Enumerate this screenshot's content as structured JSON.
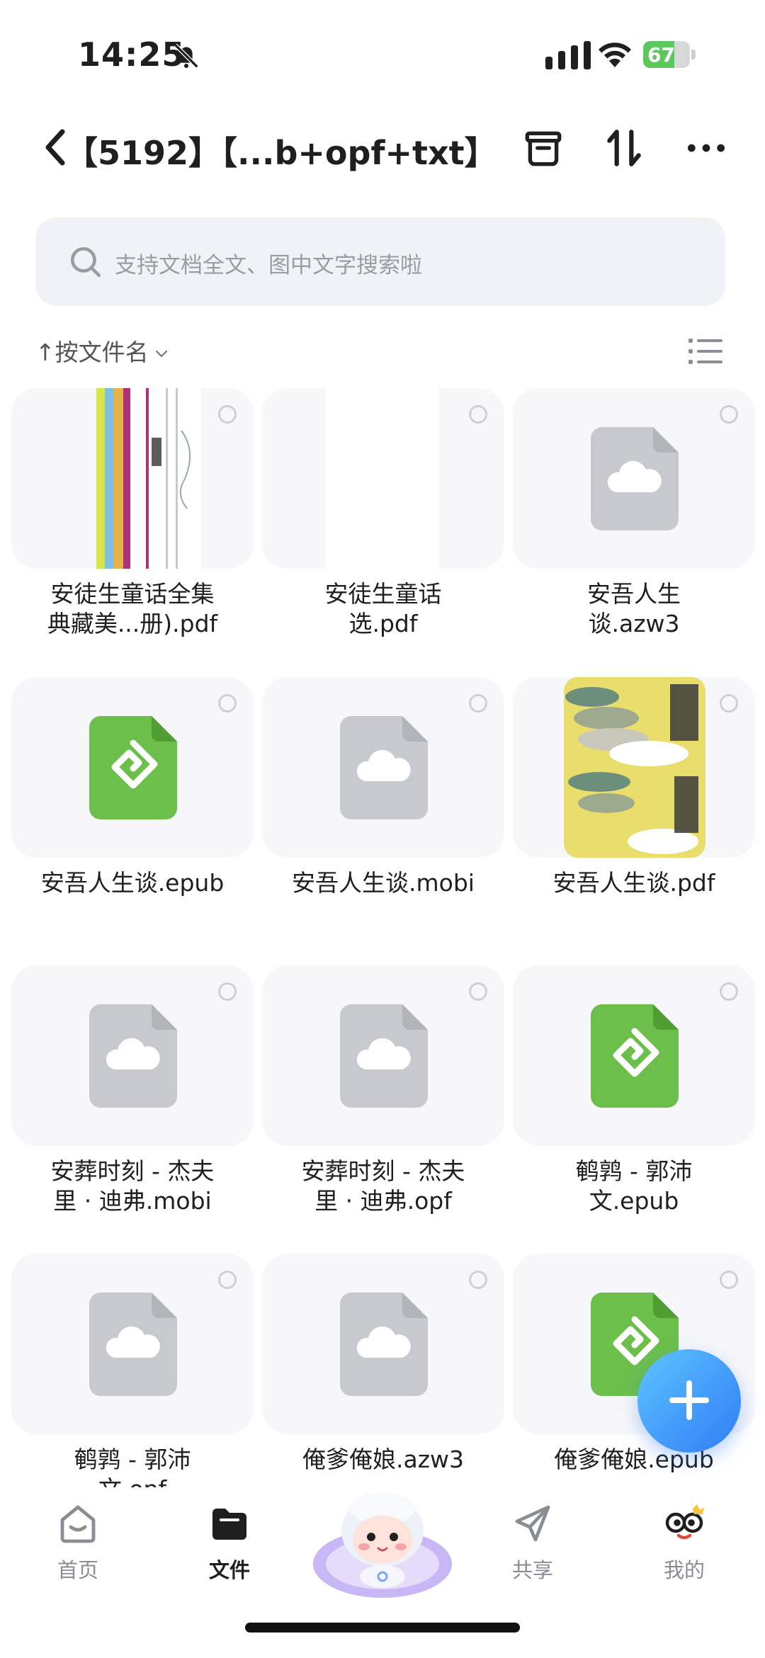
{
  "status_bar": {
    "time": "14:25",
    "battery": "67",
    "battery_level": 0.67
  },
  "header": {
    "title": "【5192】【...b+opf+txt】"
  },
  "search": {
    "placeholder": "支持文档全文、图中文字搜索啦"
  },
  "sort": {
    "label": "按文件名"
  },
  "files": [
    {
      "name": "安徒生童话全集典藏美...册).pdf",
      "line1": "安徒生童话全集",
      "line2": "典藏美...册).pdf",
      "thumb": "pdf-cover-books"
    },
    {
      "name": "安徒生童话选.pdf",
      "line1": "安徒生童话",
      "line2": "选.pdf",
      "thumb": "pdf-cover-blank"
    },
    {
      "name": "安吾人生谈.azw3",
      "line1": "安吾人生",
      "line2": "谈.azw3",
      "thumb": "cloud-file-icon"
    },
    {
      "name": "安吾人生谈.epub",
      "line1": "安吾人生谈.epub",
      "line2": "",
      "thumb": "epub-icon"
    },
    {
      "name": "安吾人生谈.mobi",
      "line1": "安吾人生谈.mobi",
      "line2": "",
      "thumb": "cloud-file-icon"
    },
    {
      "name": "安吾人生谈.pdf",
      "line1": "安吾人生谈.pdf",
      "line2": "",
      "thumb": "pdf-cover-yellow"
    },
    {
      "name": "安葬时刻 - 杰夫里 · 迪弗.mobi",
      "line1": "安葬时刻 - 杰夫",
      "line2": "里 · 迪弗.mobi",
      "thumb": "cloud-file-icon"
    },
    {
      "name": "安葬时刻 - 杰夫里 · 迪弗.opf",
      "line1": "安葬时刻 - 杰夫",
      "line2": "里 · 迪弗.opf",
      "thumb": "cloud-file-icon"
    },
    {
      "name": "鹌鹑 - 郭沛文.epub",
      "line1": "鹌鹑 - 郭沛",
      "line2": "文.epub",
      "thumb": "epub-icon"
    },
    {
      "name": "鹌鹑 - 郭沛文.opf",
      "line1": "鹌鹑 - 郭沛",
      "line2": "文.opf",
      "thumb": "cloud-file-icon"
    },
    {
      "name": "俺爹俺娘.azw3",
      "line1": "俺爹俺娘.azw3",
      "line2": "",
      "thumb": "cloud-file-icon"
    },
    {
      "name": "俺爹俺娘.epub",
      "line1": "俺爹俺娘.epub",
      "line2": "",
      "thumb": "epub-icon"
    }
  ],
  "nav": {
    "home": "首页",
    "files": "文件",
    "share": "共享",
    "mine": "我的"
  },
  "colors": {
    "accent": "#2f7cf6",
    "epub_green": "#6cbf4a",
    "battery_green": "#5ac85a"
  }
}
